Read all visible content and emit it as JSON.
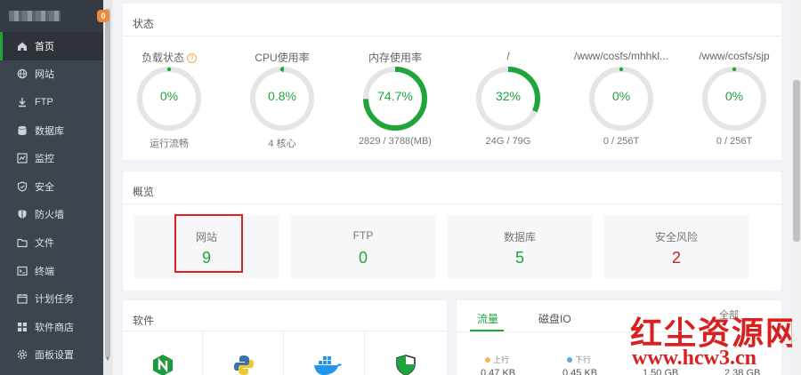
{
  "sidebar": {
    "badge": "0",
    "items": [
      {
        "label": "首页",
        "icon": "home-icon",
        "active": true
      },
      {
        "label": "网站",
        "icon": "globe-icon"
      },
      {
        "label": "FTP",
        "icon": "ftp-icon"
      },
      {
        "label": "数据库",
        "icon": "database-icon"
      },
      {
        "label": "监控",
        "icon": "monitor-icon"
      },
      {
        "label": "安全",
        "icon": "shield-icon"
      },
      {
        "label": "防火墙",
        "icon": "firewall-icon"
      },
      {
        "label": "文件",
        "icon": "folder-icon"
      },
      {
        "label": "终端",
        "icon": "terminal-icon"
      },
      {
        "label": "计划任务",
        "icon": "calendar-icon"
      },
      {
        "label": "软件商店",
        "icon": "store-icon"
      },
      {
        "label": "面板设置",
        "icon": "settings-icon"
      }
    ]
  },
  "status": {
    "title": "状态",
    "gauges": [
      {
        "label": "负载状态",
        "value": "0%",
        "percent": 0,
        "sub": "运行流畅",
        "help": "?"
      },
      {
        "label": "CPU使用率",
        "value": "0.8%",
        "percent": 0.8,
        "sub": "4 核心"
      },
      {
        "label": "内存使用率",
        "value": "74.7%",
        "percent": 74.7,
        "sub": "2829 / 3788(MB)"
      },
      {
        "label": "/",
        "value": "32%",
        "percent": 32,
        "sub": "24G / 79G"
      },
      {
        "label": "/www/cosfs/mhhkl...",
        "value": "0%",
        "percent": 0,
        "sub": "0 / 256T"
      },
      {
        "label": "/www/cosfs/sjp",
        "value": "0%",
        "percent": 0,
        "sub": "0 / 256T"
      }
    ]
  },
  "overview": {
    "title": "概览",
    "boxes": [
      {
        "label": "网站",
        "value": "9"
      },
      {
        "label": "FTP",
        "value": "0"
      },
      {
        "label": "数据库",
        "value": "5"
      },
      {
        "label": "安全风险",
        "value": "2"
      }
    ]
  },
  "software": {
    "title": "软件",
    "icons": [
      "nginx-icon",
      "python-icon",
      "docker-icon",
      "security-shield-icon"
    ]
  },
  "traffic": {
    "tabs": [
      "流量",
      "磁盘IO"
    ],
    "all_label": "全部",
    "up_label": "上行",
    "down_label": "下行",
    "values": [
      "0.47 KB",
      "0.45 KB",
      "1.50 GB",
      "2.38 GB"
    ]
  },
  "watermark": {
    "title": "红尘资源网",
    "url": "www.hcw3.cn"
  },
  "colors": {
    "accent": "#20a53a",
    "danger": "#cc2222",
    "sidebar": "#3c444d"
  }
}
